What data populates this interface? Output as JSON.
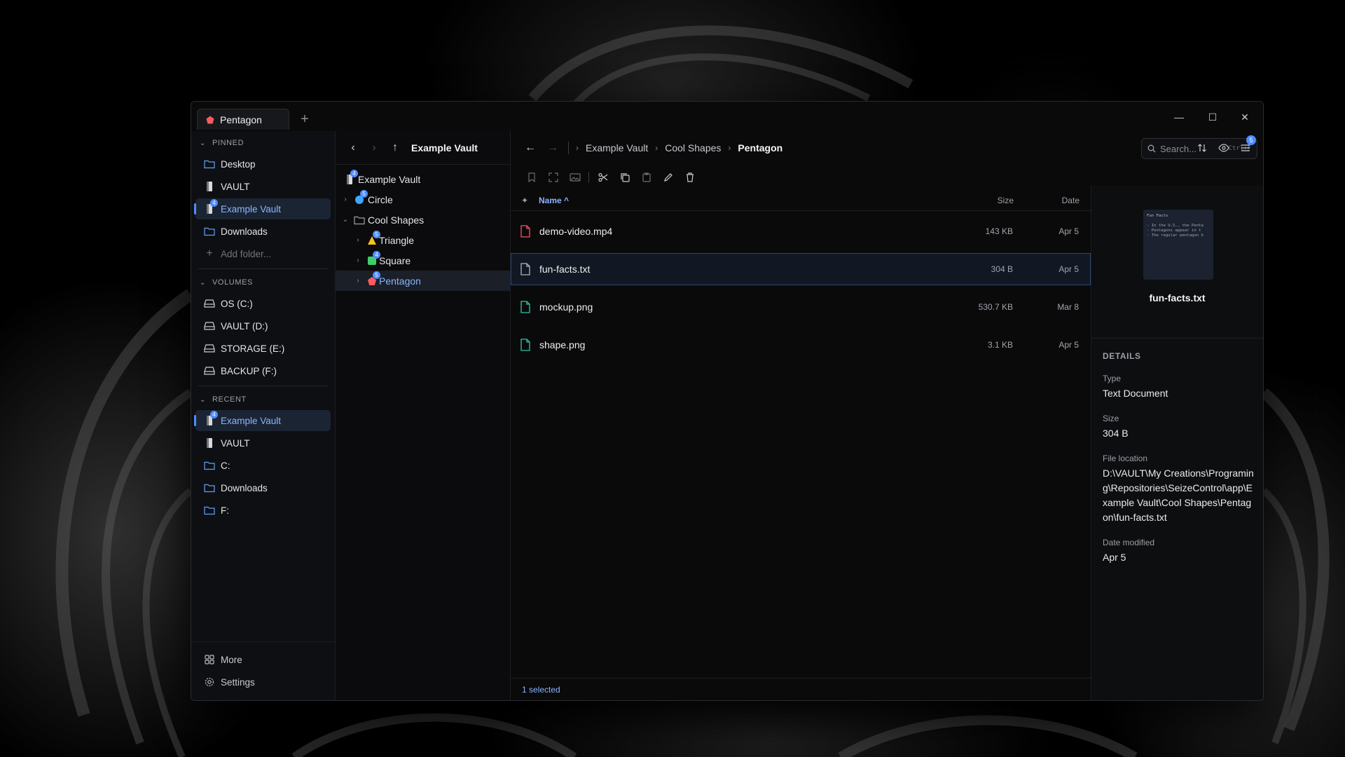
{
  "window": {
    "tab_label": "Pentagon",
    "new_tab": "+",
    "controls": {
      "minimize": "—",
      "maximize": "☐",
      "close": "✕"
    }
  },
  "sidebar": {
    "pinned": {
      "header": "PINNED",
      "items": [
        {
          "label": "Desktop",
          "icon": "folder-icon"
        },
        {
          "label": "VAULT",
          "icon": "vault-drive-icon"
        },
        {
          "label": "Example Vault",
          "icon": "vault-drive-icon",
          "badge": "4",
          "active": true
        },
        {
          "label": "Downloads",
          "icon": "folder-icon"
        }
      ],
      "add_folder": "Add folder..."
    },
    "volumes": {
      "header": "VOLUMES",
      "items": [
        {
          "label": "OS (C:)",
          "icon": "drive-icon"
        },
        {
          "label": "VAULT (D:)",
          "icon": "drive-icon"
        },
        {
          "label": "STORAGE (E:)",
          "icon": "drive-icon"
        },
        {
          "label": "BACKUP (F:)",
          "icon": "drive-icon"
        }
      ]
    },
    "recent": {
      "header": "RECENT",
      "items": [
        {
          "label": "Example Vault",
          "icon": "vault-drive-icon",
          "badge": "4",
          "active": true
        },
        {
          "label": "VAULT",
          "icon": "vault-drive-icon"
        },
        {
          "label": "C:",
          "icon": "folder-icon"
        },
        {
          "label": "Downloads",
          "icon": "folder-icon"
        },
        {
          "label": "F:",
          "icon": "folder-icon"
        }
      ]
    },
    "more": "More",
    "settings": "Settings"
  },
  "tree": {
    "title": "Example Vault",
    "nodes": [
      {
        "label": "Example Vault",
        "badge": "4",
        "icon": "vault-drive-icon",
        "color": "#cfd3da"
      },
      {
        "label": "Circle",
        "badge": "5",
        "icon": "circle-shape-icon",
        "color": "#3ea6ff"
      },
      {
        "label": "Cool Shapes",
        "icon": "folder-icon",
        "color": "#9aa0a8"
      },
      {
        "label": "Triangle",
        "badge": "5",
        "icon": "triangle-shape-icon",
        "color": "#f5c518"
      },
      {
        "label": "Square",
        "badge": "4",
        "icon": "square-shape-icon",
        "color": "#3ccf6a"
      },
      {
        "label": "Pentagon",
        "badge": "5",
        "icon": "pentagon-shape-icon",
        "color": "#ff5a5f",
        "active": true
      }
    ]
  },
  "address": {
    "crumbs": [
      "Example Vault",
      "Cool Shapes",
      "Pentagon"
    ],
    "search_placeholder": "Search...",
    "search_shortcut": "Ctrl+F"
  },
  "columns": {
    "name": "Name ^",
    "size": "Size",
    "date": "Date"
  },
  "files": [
    {
      "name": "demo-video.mp4",
      "size": "143 KB",
      "date": "Apr 5",
      "icon": "video-file-icon",
      "color": "#ff4d6a"
    },
    {
      "name": "fun-facts.txt",
      "size": "304 B",
      "date": "Apr 5",
      "icon": "text-file-icon",
      "color": "#b0b4bb",
      "selected": true
    },
    {
      "name": "mockup.png",
      "size": "530.7 KB",
      "date": "Mar 8",
      "icon": "image-file-icon",
      "color": "#2ec8a6"
    },
    {
      "name": "shape.png",
      "size": "3.1 KB",
      "date": "Apr 5",
      "icon": "image-file-icon",
      "color": "#2ec8a6"
    }
  ],
  "status": "1 selected",
  "toolbar_badge": "5",
  "details": {
    "preview_title": "Fun Facts",
    "preview_lines": [
      "- In the U.S., the Penta",
      "- Pentagons appear in t",
      "- The regular pentagon h"
    ],
    "file_name": "fun-facts.txt",
    "header": "DETAILS",
    "type_label": "Type",
    "type_value": "Text Document",
    "size_label": "Size",
    "size_value": "304 B",
    "location_label": "File location",
    "location_value": "D:\\VAULT\\My Creations\\Programing\\Repositories\\SeizeControl\\app\\Example Vault\\Cool Shapes\\Pentagon\\fun-facts.txt",
    "modified_label": "Date modified",
    "modified_value": "Apr 5"
  },
  "colors": {
    "accent": "#4f8cff",
    "accent_text": "#8ab4ff",
    "pentagon": "#ff5a5f"
  }
}
